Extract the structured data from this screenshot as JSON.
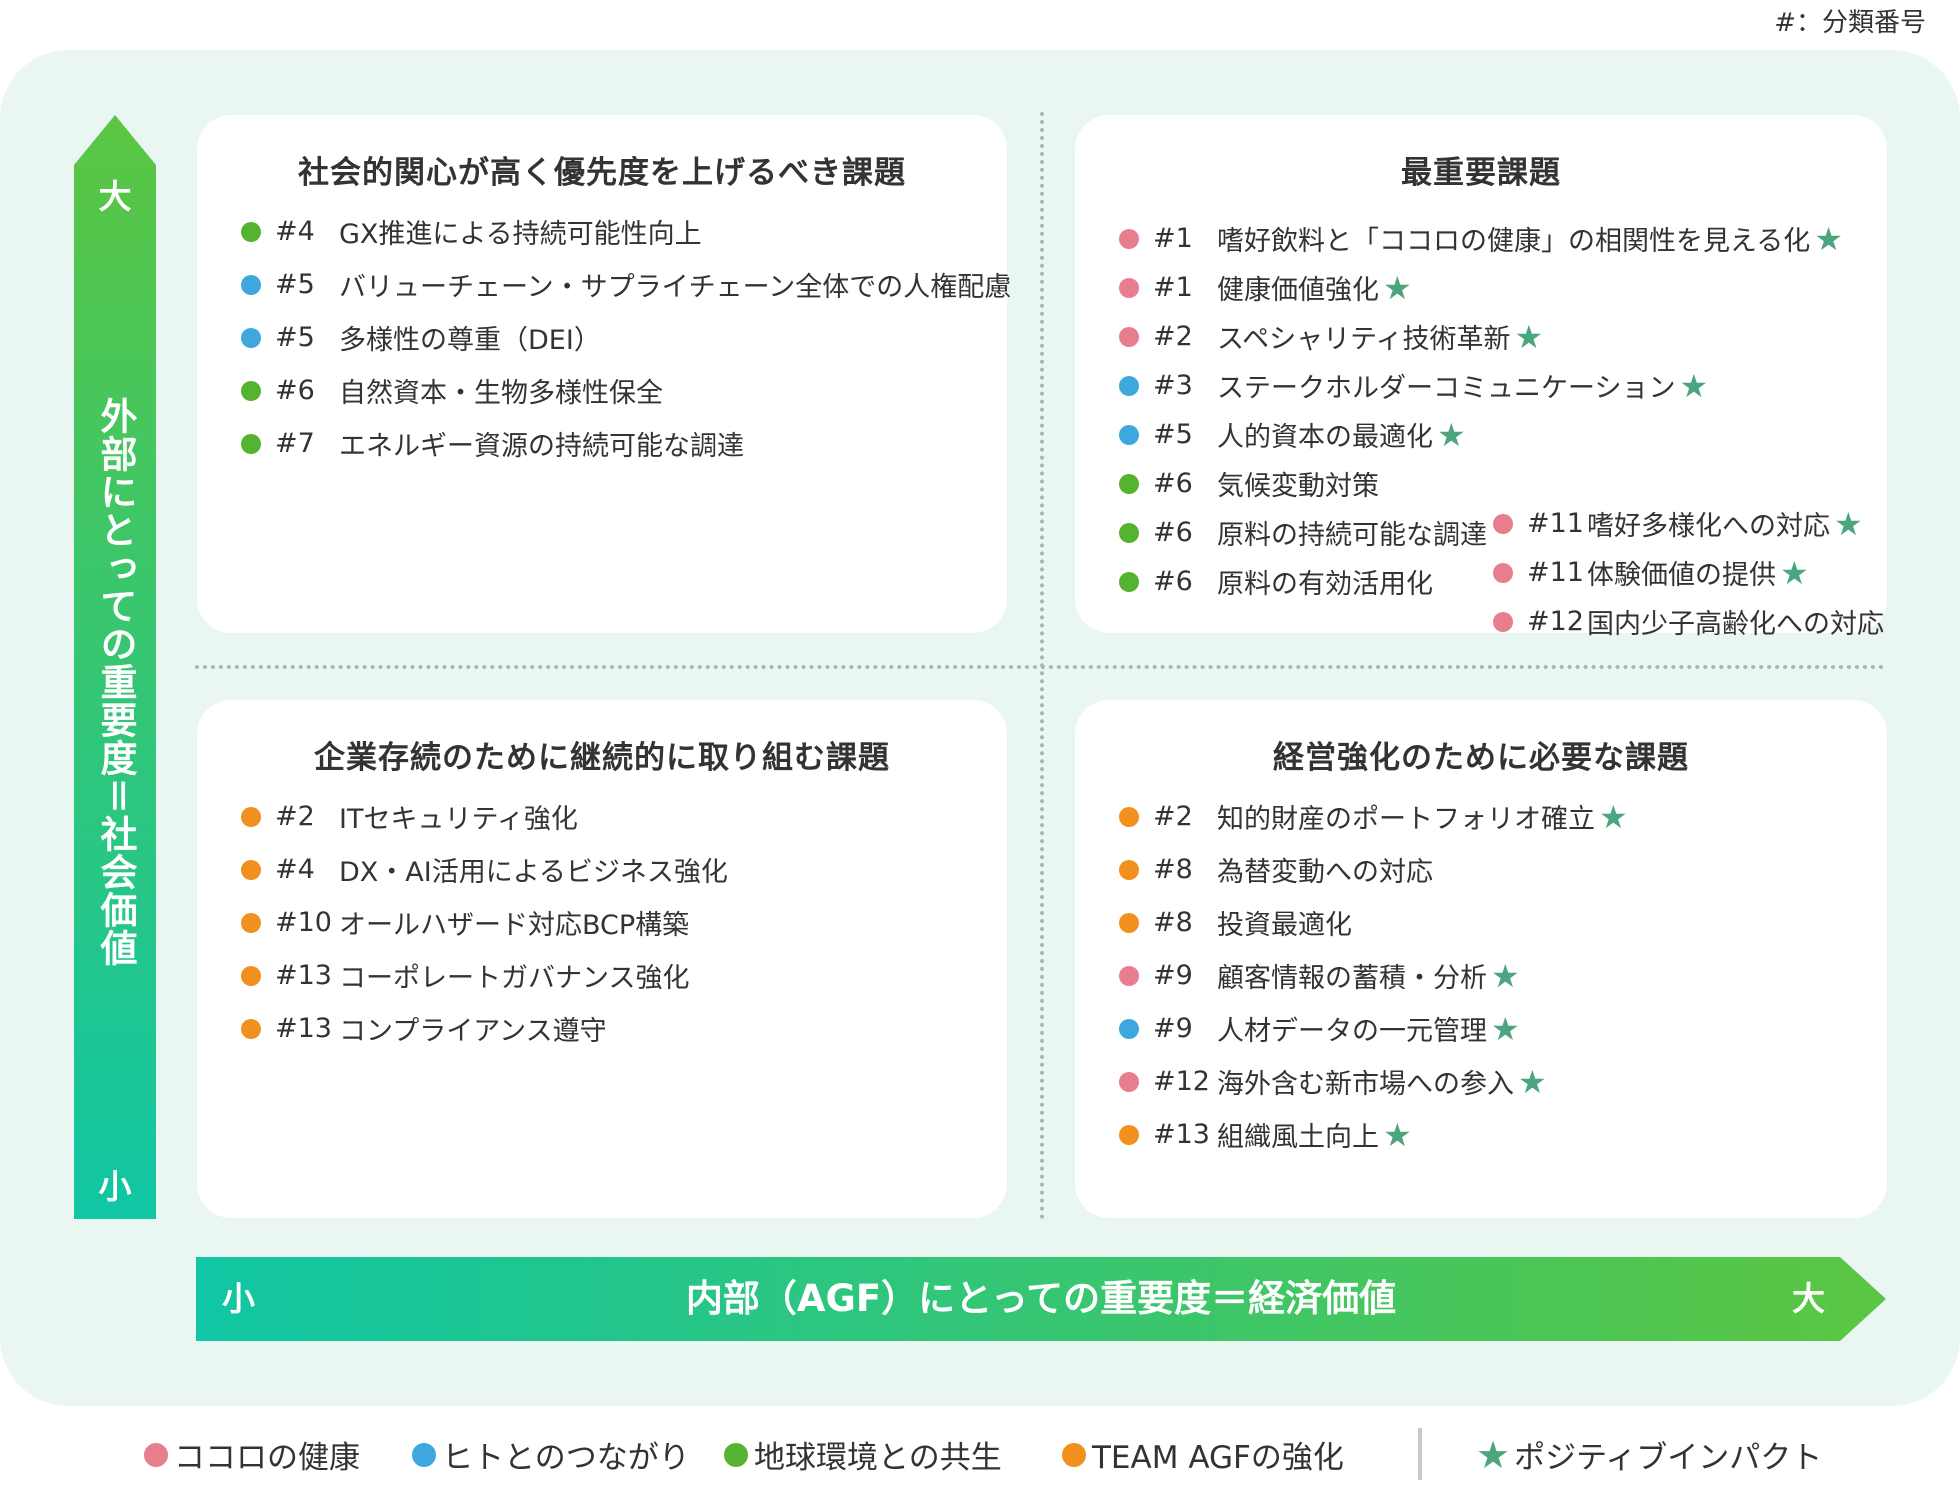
{
  "note": "#：分類番号",
  "colors": {
    "kokoro": "#e87d8d",
    "hito": "#3ea7dd",
    "earth": "#56b32f",
    "team": "#f18f1f",
    "star": "#4ba57f",
    "gradient_green": "#5bc642",
    "gradient_teal": "#10c6a4"
  },
  "vertical_axis": {
    "label": "外部にとっての重要度＝社会価値",
    "high": "大",
    "low": "小"
  },
  "horizontal_axis": {
    "label": "内部（AGF）にとっての重要度＝経済価値",
    "low": "小",
    "high": "大"
  },
  "quadrants": {
    "top_left": {
      "title": "社会的関心が高く優先度を上げるべき課題",
      "items": [
        {
          "num": "#4",
          "text": "GX推進による持続可能性向上",
          "cat": "earth",
          "star": false
        },
        {
          "num": "#5",
          "text": "バリューチェーン・サプライチェーン全体での人権配慮",
          "cat": "hito",
          "star": false
        },
        {
          "num": "#5",
          "text": "多様性の尊重（DEI）",
          "cat": "hito",
          "star": false
        },
        {
          "num": "#6",
          "text": "自然資本・生物多様性保全",
          "cat": "earth",
          "star": false
        },
        {
          "num": "#7",
          "text": "エネルギー資源の持続可能な調達",
          "cat": "earth",
          "star": false
        }
      ]
    },
    "top_right": {
      "title": "最重要課題",
      "items": [
        {
          "num": "#1",
          "text": "嗜好飲料と「ココロの健康」の相関性を見える化",
          "cat": "kokoro",
          "star": true
        },
        {
          "num": "#1",
          "text": "健康価値強化",
          "cat": "kokoro",
          "star": true
        },
        {
          "num": "#2",
          "text": "スペシャリティ技術革新",
          "cat": "kokoro",
          "star": true
        },
        {
          "num": "#3",
          "text": "ステークホルダーコミュニケーション",
          "cat": "hito",
          "star": true
        },
        {
          "num": "#5",
          "text": "人的資本の最適化",
          "cat": "hito",
          "star": true
        },
        {
          "num": "#6",
          "text": "気候変動対策",
          "cat": "earth",
          "star": false
        },
        {
          "num": "#6",
          "text": "原料の持続可能な調達",
          "cat": "earth",
          "star": false
        },
        {
          "num": "#6",
          "text": "原料の有効活用化",
          "cat": "earth",
          "star": false
        }
      ],
      "items_col2": [
        {
          "num": "#11",
          "text": "嗜好多様化への対応",
          "cat": "kokoro",
          "star": true
        },
        {
          "num": "#11",
          "text": "体験価値の提供",
          "cat": "kokoro",
          "star": true
        },
        {
          "num": "#12",
          "text": "国内少子高齢化への対応",
          "cat": "kokoro",
          "star": false
        }
      ]
    },
    "bottom_left": {
      "title": "企業存続のために継続的に取り組む課題",
      "items": [
        {
          "num": "#2",
          "text": "ITセキュリティ強化",
          "cat": "team",
          "star": false
        },
        {
          "num": "#4",
          "text": "DX・AI活用によるビジネス強化",
          "cat": "team",
          "star": false
        },
        {
          "num": "#10",
          "text": "オールハザード対応BCP構築",
          "cat": "team",
          "star": false
        },
        {
          "num": "#13",
          "text": "コーポレートガバナンス強化",
          "cat": "team",
          "star": false
        },
        {
          "num": "#13",
          "text": "コンプライアンス遵守",
          "cat": "team",
          "star": false
        }
      ]
    },
    "bottom_right": {
      "title": "経営強化のために必要な課題",
      "items": [
        {
          "num": "#2",
          "text": "知的財産のポートフォリオ確立",
          "cat": "team",
          "star": true
        },
        {
          "num": "#8",
          "text": "為替変動への対応",
          "cat": "team",
          "star": false
        },
        {
          "num": "#8",
          "text": "投資最適化",
          "cat": "team",
          "star": false
        },
        {
          "num": "#9",
          "text": "顧客情報の蓄積・分析",
          "cat": "kokoro",
          "star": true
        },
        {
          "num": "#9",
          "text": "人材データの一元管理",
          "cat": "hito",
          "star": true
        },
        {
          "num": "#12",
          "text": "海外含む新市場への参入",
          "cat": "kokoro",
          "star": true
        },
        {
          "num": "#13",
          "text": "組織風土向上",
          "cat": "team",
          "star": true
        }
      ]
    }
  },
  "legend": [
    {
      "cat": "kokoro",
      "label": "ココロの健康"
    },
    {
      "cat": "hito",
      "label": "ヒトとのつながり"
    },
    {
      "cat": "earth",
      "label": "地球環境との共生"
    },
    {
      "cat": "team",
      "label": "TEAM AGFの強化"
    }
  ],
  "legend_star": "ポジティブインパクト",
  "star_glyph": "★"
}
